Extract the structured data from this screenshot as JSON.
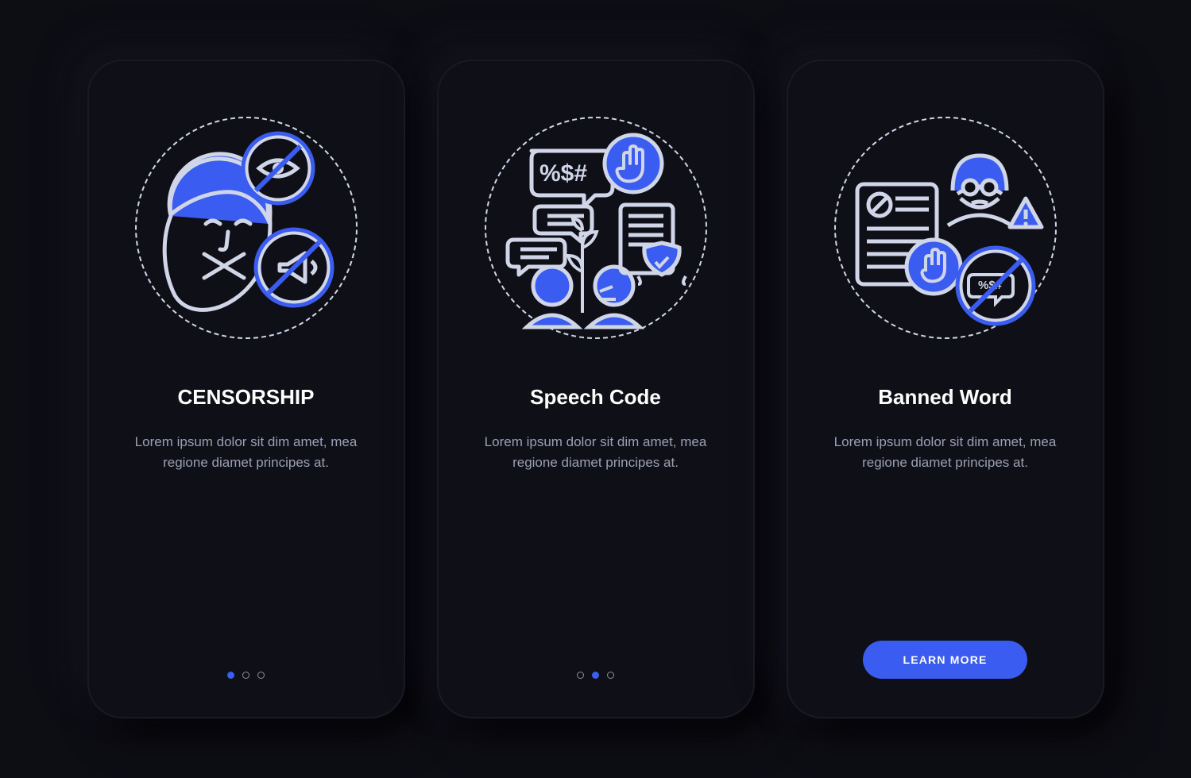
{
  "colors": {
    "accent": "#3a5cf0",
    "bg": "#0d0d14",
    "card": "#0f0f17",
    "text": "#ffffff",
    "muted": "#9aa0b4",
    "stroke": "#d0d6e8"
  },
  "screens": [
    {
      "title": "CENSORSHIP",
      "description": "Lorem ipsum dolor sit dim amet, mea regione diamet principes at.",
      "icon": "censorship-icon",
      "dots": {
        "total": 3,
        "active": 0
      }
    },
    {
      "title": "Speech Code",
      "description": "Lorem ipsum dolor sit dim amet, mea regione diamet principes at.",
      "icon": "speech-code-icon",
      "dots": {
        "total": 3,
        "active": 1
      }
    },
    {
      "title": "Banned Word",
      "description": "Lorem ipsum dolor sit dim amet, mea regione diamet principes at.",
      "icon": "banned-word-icon",
      "cta_label": "LEARN MORE"
    }
  ]
}
